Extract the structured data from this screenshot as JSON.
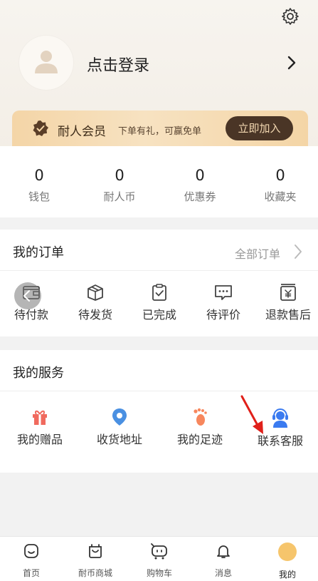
{
  "profile": {
    "login_text": "点击登录",
    "settings_icon": "gear-icon",
    "avatar_icon": "user-avatar-icon"
  },
  "membership": {
    "title": "耐人会员",
    "subtitle": "下单有礼，可赢免单",
    "join_label": "立即加入"
  },
  "stats": [
    {
      "value": "0",
      "label": "钱包"
    },
    {
      "value": "0",
      "label": "耐人币"
    },
    {
      "value": "0",
      "label": "优惠券"
    },
    {
      "value": "0",
      "label": "收藏夹"
    }
  ],
  "orders": {
    "title": "我的订单",
    "all_label": "全部订单",
    "items": [
      {
        "label": "待付款",
        "icon": "wallet-icon"
      },
      {
        "label": "待发货",
        "icon": "box-icon"
      },
      {
        "label": "已完成",
        "icon": "clipboard-check-icon"
      },
      {
        "label": "待评价",
        "icon": "comment-icon"
      },
      {
        "label": "退款售后",
        "icon": "refund-icon"
      }
    ]
  },
  "services": {
    "title": "我的服务",
    "items": [
      {
        "label": "我的赠品",
        "icon": "gift-icon",
        "color": "#f06a5e"
      },
      {
        "label": "收货地址",
        "icon": "location-pin-icon",
        "color": "#4a90e2"
      },
      {
        "label": "我的足迹",
        "icon": "footprint-icon",
        "color": "#f7875d"
      },
      {
        "label": "联系客服",
        "icon": "customer-service-icon",
        "color": "#3b7bf0"
      }
    ]
  },
  "tabbar": [
    {
      "label": "首页",
      "icon": "home-icon"
    },
    {
      "label": "耐币商城",
      "icon": "shop-icon"
    },
    {
      "label": "购物车",
      "icon": "cart-icon"
    },
    {
      "label": "消息",
      "icon": "bell-icon"
    },
    {
      "label": "我的",
      "icon": "me-icon",
      "active": true
    }
  ],
  "colors": {
    "accent_dark": "#4a3526",
    "member_gold": "#f4d5a7",
    "annotation_red": "#e0201a"
  }
}
